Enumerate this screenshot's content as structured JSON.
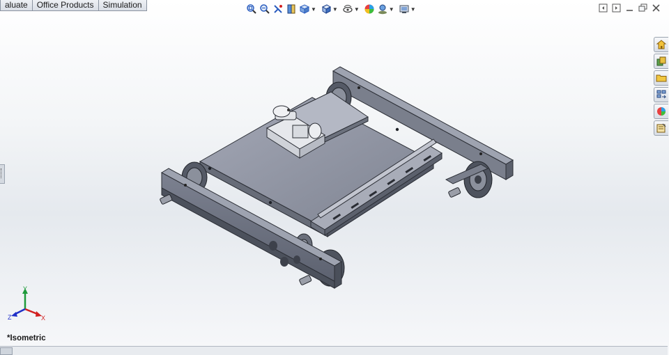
{
  "tabs": [
    "aluate",
    "Office Products",
    "Simulation"
  ],
  "headsup_toolbar": [
    "zoom-to-fit-icon",
    "zoom-to-area-icon",
    "previous-view-icon",
    "section-view-icon",
    "view-orientation-icon",
    "display-style-icon",
    "hide-show-items-icon",
    "edit-appearance-icon",
    "apply-scene-icon",
    "view-settings-icon"
  ],
  "window_controls": [
    "tile-left-icon",
    "tile-right-icon",
    "minimize-icon",
    "restore-icon",
    "close-icon"
  ],
  "task_pane": [
    "solidworks-resources-icon",
    "design-library-icon",
    "file-explorer-icon",
    "view-palette-icon",
    "appearances-scenes-icon",
    "custom-properties-icon"
  ],
  "view": {
    "name": "*Isometric"
  },
  "triad": {
    "x": "X",
    "y": "Y",
    "z": "Z"
  },
  "colors": {
    "accent_blue": "#2a5cbf",
    "triad_x": "#d22020",
    "triad_y": "#1e9a3a",
    "triad_z": "#2030c8",
    "part_gray": "#8a8f9a"
  }
}
